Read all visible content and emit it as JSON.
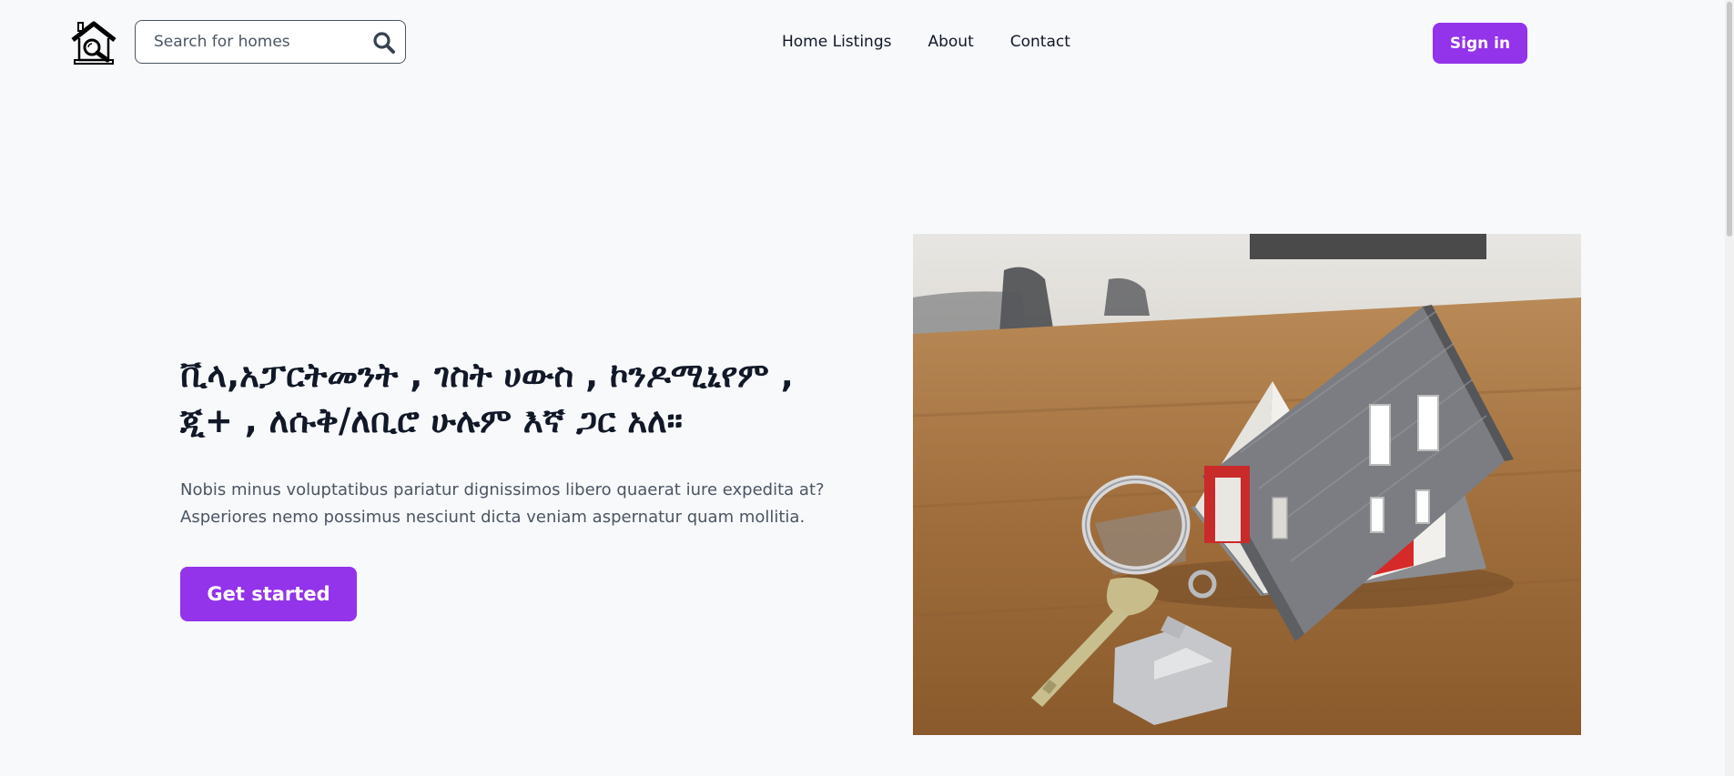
{
  "header": {
    "logo_icon": "house-magnifier-logo-icon",
    "search": {
      "placeholder": "Search for homes",
      "value": "",
      "icon": "search-icon"
    },
    "nav": [
      {
        "label": "Home Listings"
      },
      {
        "label": "About"
      },
      {
        "label": "Contact"
      }
    ],
    "sign_in_label": "Sign in"
  },
  "hero": {
    "title": "ቪላ,አፓርትመንት , ገስት ሀውስ , ኮንዶሚኒየም , ጂ+ , ለሱቅ/ለቢሮ ሁሉም እኛ ጋር አለ።",
    "text": "Nobis minus voluptatibus pariatur dignissimos libero quaerat iure expedita at? Asperiores nemo possimus nesciunt dicta veniam aspernatur quam mollitia.",
    "cta_label": "Get started",
    "image": "house-model-with-keys-photo"
  },
  "colors": {
    "accent": "#9333ea",
    "background": "#f8f9fb",
    "text": "#111827",
    "muted_text": "#4b5563"
  }
}
